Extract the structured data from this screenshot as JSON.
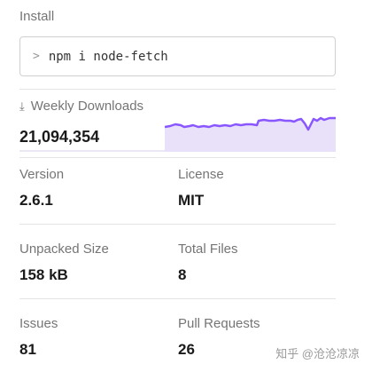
{
  "install": {
    "title": "Install",
    "prompt_icon": "chevron-right-icon",
    "command": "npm i node-fetch"
  },
  "weekly_downloads": {
    "label": "Weekly Downloads",
    "icon": "download-icon",
    "value": "21,094,354",
    "accent": "#8956ff",
    "fill": "#e8e1f9"
  },
  "stats": {
    "version": {
      "label": "Version",
      "value": "2.6.1"
    },
    "license": {
      "label": "License",
      "value": "MIT"
    },
    "unpacked_size": {
      "label": "Unpacked Size",
      "value": "158 kB"
    },
    "total_files": {
      "label": "Total Files",
      "value": "8"
    },
    "issues": {
      "label": "Issues",
      "value": "81"
    },
    "pull_requests": {
      "label": "Pull Requests",
      "value": "26"
    }
  },
  "watermark": "知乎 @沧沧凉凉"
}
